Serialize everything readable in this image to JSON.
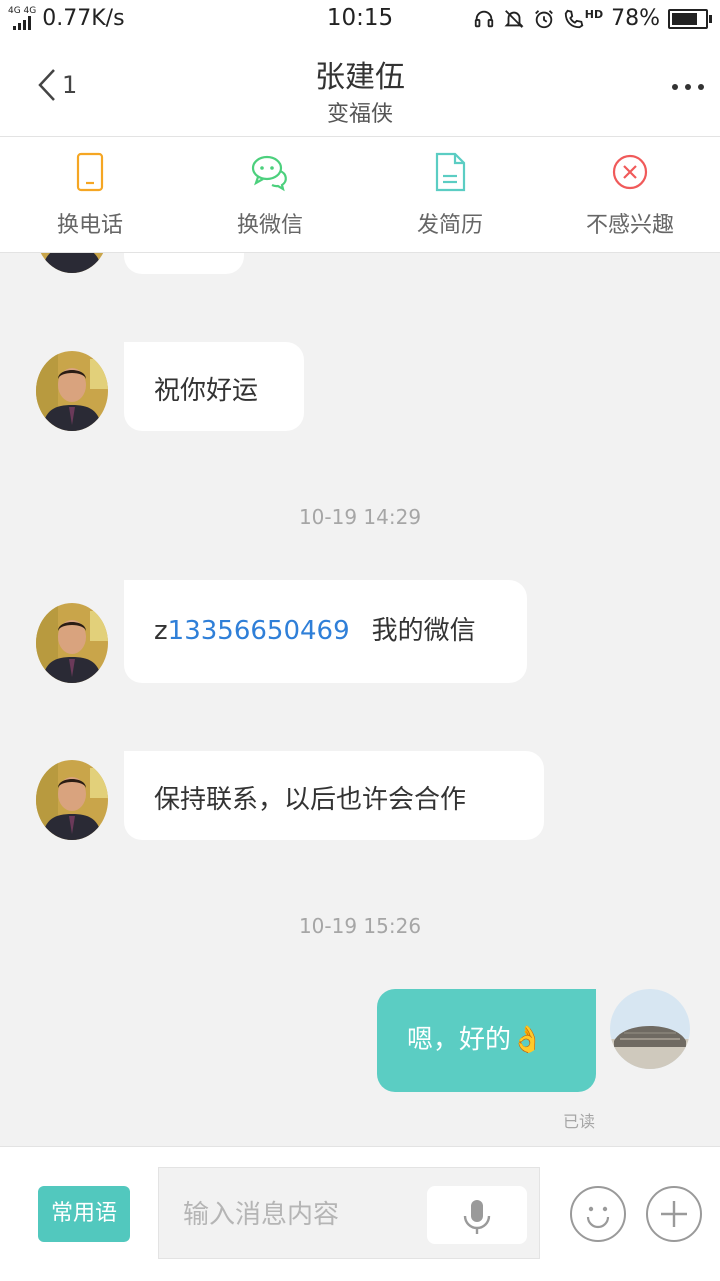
{
  "status_bar": {
    "network_type_top": "4G 4G",
    "speed": "0.77K/s",
    "time": "10:15",
    "hd_label": "HD",
    "battery_percent": "78%",
    "battery_level": 0.78
  },
  "header": {
    "back_count": "1",
    "title": "张建伍",
    "subtitle": "变福侠"
  },
  "actions": [
    {
      "label": "换电话",
      "icon": "phone-icon",
      "color": "#f5a623"
    },
    {
      "label": "换微信",
      "icon": "wechat-icon",
      "color": "#4cd07d"
    },
    {
      "label": "发简历",
      "icon": "resume-icon",
      "color": "#5bcdc3"
    },
    {
      "label": "不感兴趣",
      "icon": "close-circle-icon",
      "color": "#f05a5a"
    }
  ],
  "messages": {
    "m1": {
      "text": "祝你好运"
    },
    "ts1": "10-19 14:29",
    "m2": {
      "prefix": "z",
      "link": "13356650469",
      "suffix": "我的微信"
    },
    "m3": {
      "text": "保持联系，以后也许会合作"
    },
    "ts2": "10-19 15:26",
    "m4": {
      "text": "嗯，好的",
      "emoji": "👌",
      "status": "已读"
    }
  },
  "input_bar": {
    "phrases_label": "常用语",
    "placeholder": "输入消息内容"
  },
  "colors": {
    "accent": "#5bcdc3",
    "link": "#2f7fd8"
  }
}
